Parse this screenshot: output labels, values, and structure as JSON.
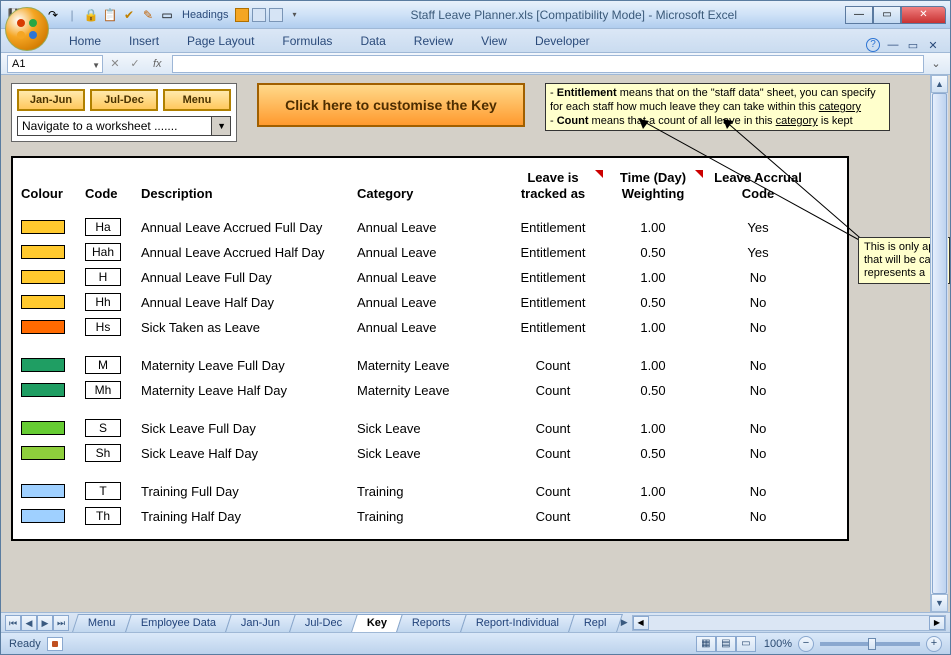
{
  "window_title": "Staff Leave Planner.xls  [Compatibility Mode] - Microsoft Excel",
  "qat_headings": "Headings",
  "ribbon_tabs": [
    "Home",
    "Insert",
    "Page Layout",
    "Formulas",
    "Data",
    "Review",
    "View",
    "Developer"
  ],
  "name_box": "A1",
  "fx_label": "fx",
  "buttons": {
    "jan_jun": "Jan-Jun",
    "jul_dec": "Jul-Dec",
    "menu": "Menu"
  },
  "nav_placeholder": "Navigate to a worksheet .......",
  "customise": "Click here to customise the Key",
  "info_html_parts": {
    "p1a": "- ",
    "p1b": "Entitlement",
    "p1c": " means that on the \"staff data\" sheet, you can specify for each staff how much leave they can take within this ",
    "p1d": "category",
    "p2a": "- ",
    "p2b": "Count",
    "p2c": " means that a count of all leave in this ",
    "p2d": "category",
    "p2e": " is kept"
  },
  "callout2_l1": "This is only ap",
  "callout2_l2": "that will be ca",
  "callout2_l3": "represents a",
  "headers": {
    "colour": "Colour",
    "code": "Code",
    "desc": "Description",
    "cat": "Category",
    "track_l1": "Leave is",
    "track_l2": "tracked as",
    "weight_l1": "Time (Day)",
    "weight_l2": "Weighting",
    "accr_l1": "Leave Accrual",
    "accr_l2": "Code"
  },
  "rows": [
    {
      "colour": "#ffc92e",
      "code": "Ha",
      "desc": "Annual Leave Accrued Full Day",
      "cat": "Annual Leave",
      "track": "Entitlement",
      "weight": "1.00",
      "accr": "Yes"
    },
    {
      "colour": "#ffc92e",
      "code": "Hah",
      "desc": "Annual Leave Accrued Half Day",
      "cat": "Annual Leave",
      "track": "Entitlement",
      "weight": "0.50",
      "accr": "Yes"
    },
    {
      "colour": "#ffc92e",
      "code": "H",
      "desc": "Annual Leave Full Day",
      "cat": "Annual Leave",
      "track": "Entitlement",
      "weight": "1.00",
      "accr": "No"
    },
    {
      "colour": "#ffc92e",
      "code": "Hh",
      "desc": "Annual Leave Half Day",
      "cat": "Annual Leave",
      "track": "Entitlement",
      "weight": "0.50",
      "accr": "No"
    },
    {
      "colour": "#ff6a00",
      "code": "Hs",
      "desc": "Sick Taken as Leave",
      "cat": "Annual Leave",
      "track": "Entitlement",
      "weight": "1.00",
      "accr": "No"
    },
    {
      "gap": true
    },
    {
      "colour": "#1f9e63",
      "code": "M",
      "desc": "Maternity Leave Full Day",
      "cat": "Maternity Leave",
      "track": "Count",
      "weight": "1.00",
      "accr": "No"
    },
    {
      "colour": "#1f9e63",
      "code": "Mh",
      "desc": "Maternity Leave Half Day",
      "cat": "Maternity Leave",
      "track": "Count",
      "weight": "0.50",
      "accr": "No"
    },
    {
      "gap": true
    },
    {
      "colour": "#66cc33",
      "code": "S",
      "desc": "Sick Leave Full Day",
      "cat": "Sick Leave",
      "track": "Count",
      "weight": "1.00",
      "accr": "No"
    },
    {
      "colour": "#8ecf3c",
      "code": "Sh",
      "desc": "Sick Leave Half Day",
      "cat": "Sick Leave",
      "track": "Count",
      "weight": "0.50",
      "accr": "No"
    },
    {
      "gap": true
    },
    {
      "colour": "#9fd0ff",
      "code": "T",
      "desc": "Training Full Day",
      "cat": "Training",
      "track": "Count",
      "weight": "1.00",
      "accr": "No"
    },
    {
      "colour": "#9fd0ff",
      "code": "Th",
      "desc": "Training Half Day",
      "cat": "Training",
      "track": "Count",
      "weight": "0.50",
      "accr": "No"
    }
  ],
  "sheet_tabs": [
    "Menu",
    "Employee Data",
    "Jan-Jun",
    "Jul-Dec",
    "Key",
    "Reports",
    "Report-Individual",
    "Repl"
  ],
  "active_sheet": "Key",
  "status_ready": "Ready",
  "zoom_pct": "100%"
}
